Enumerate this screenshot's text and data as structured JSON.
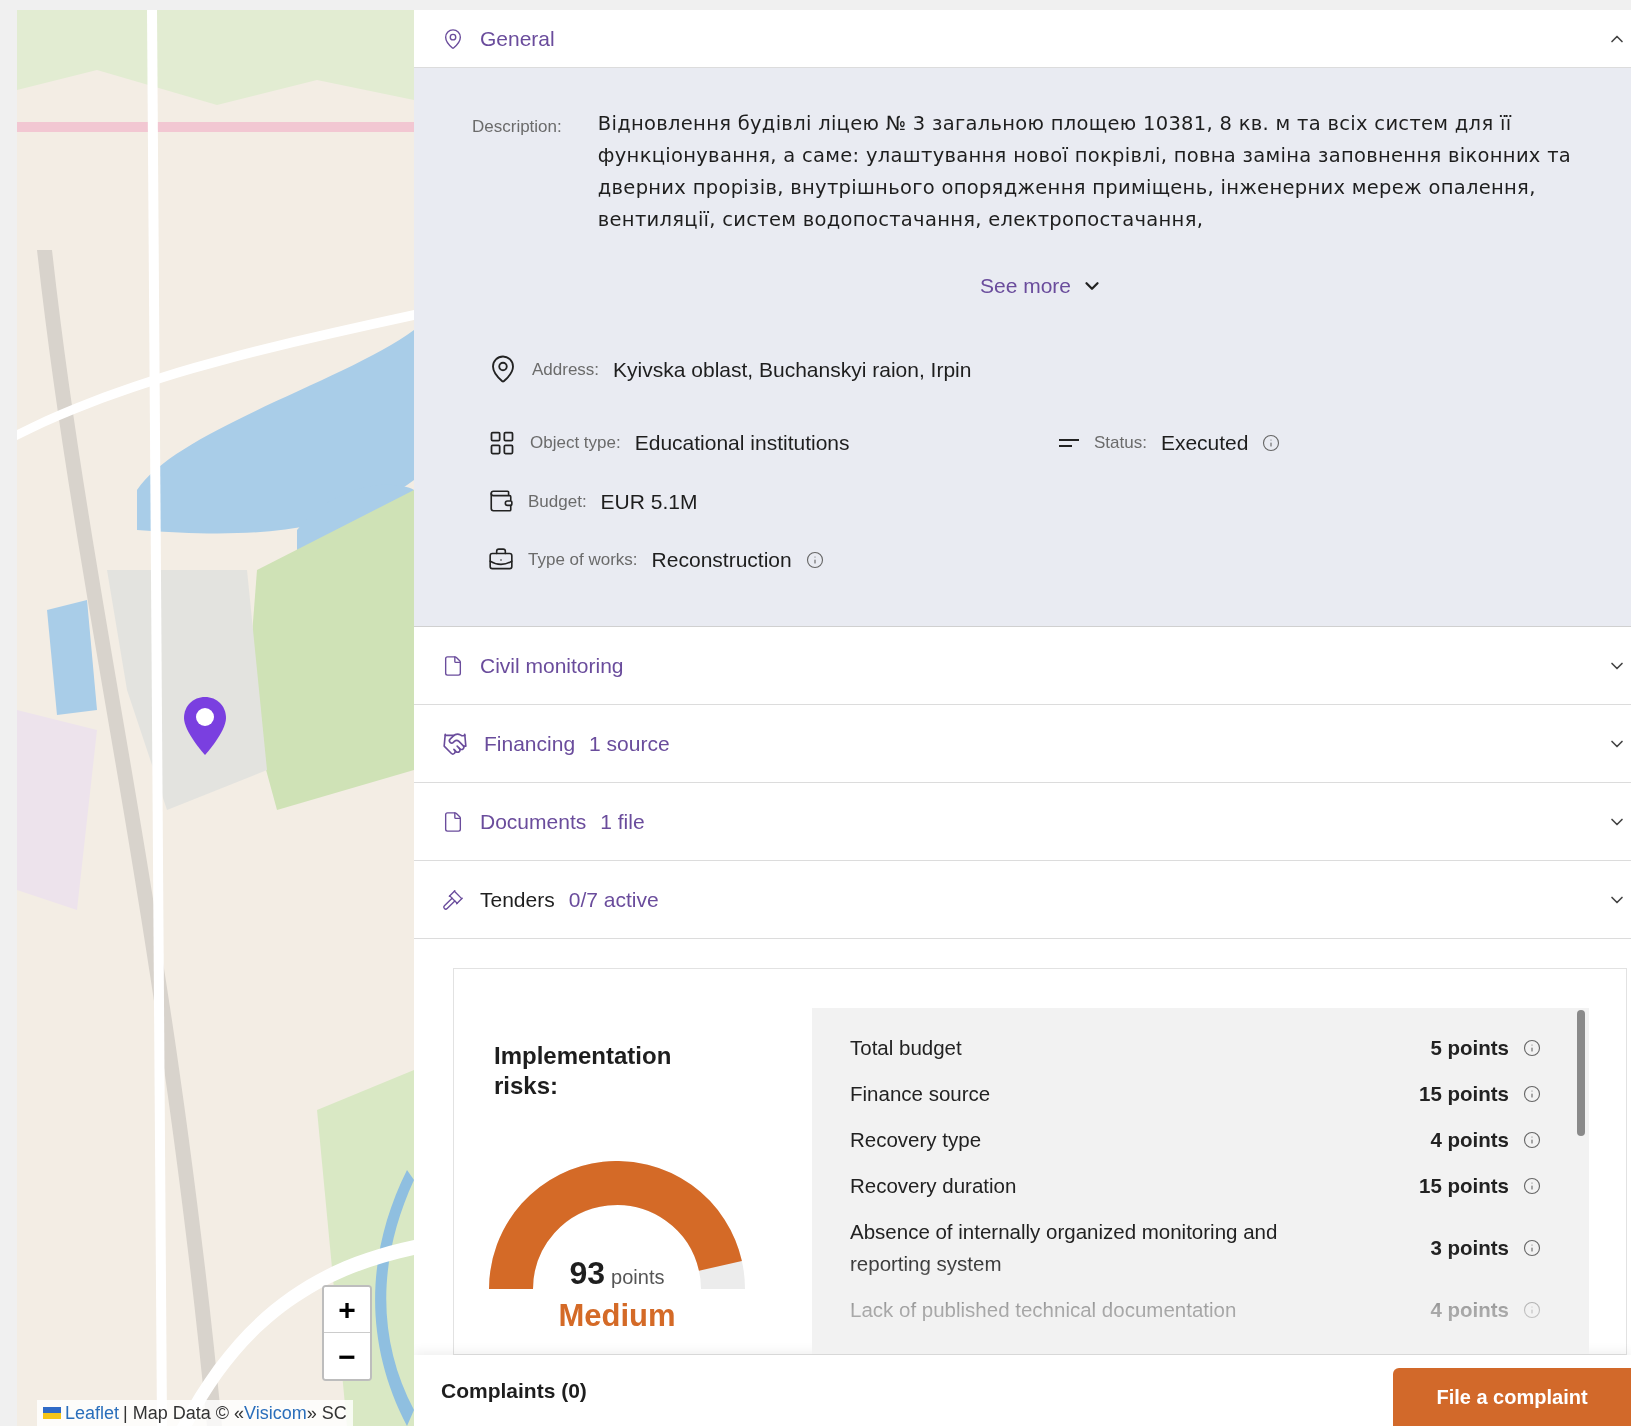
{
  "map": {
    "zoom_in": "+",
    "zoom_out": "−",
    "attribution": {
      "link": "Leaflet",
      "middle": "| Map Data © «",
      "source": "Visicom",
      "end": "» SC"
    }
  },
  "sections": [
    {
      "kind": "general",
      "title": "General",
      "expanded": true
    },
    {
      "kind": "monitoring",
      "title": "Civil monitoring",
      "expanded": false
    },
    {
      "kind": "financing",
      "title": "Financing",
      "count": "1 source",
      "expanded": false
    },
    {
      "kind": "documents",
      "title": "Documents",
      "count": "1 file",
      "expanded": false
    },
    {
      "kind": "tenders",
      "title": "Tenders",
      "count": "0/7 active",
      "expanded": false
    }
  ],
  "general": {
    "description_label": "Description:",
    "description": "Відновлення будівлі ліцею № 3 загальною площею 10381, 8 кв. м та всіх систем для її функціонування, а саме: улаштування нової покрівлі, повна заміна заповнення віконних та дверних прорізів, внутрішнього опорядження приміщень, інженерних мереж опалення, вентиляції, систем водопостачання, електропостачання,",
    "see_more": "See more",
    "address": {
      "label": "Address:",
      "value": "Kyivska oblast, Buchanskyi raion, Irpin"
    },
    "object_type": {
      "label": "Object type:",
      "value": "Educational institutions"
    },
    "status": {
      "label": "Status:",
      "value": "Executed",
      "info": true
    },
    "budget": {
      "label": "Budget:",
      "value": "EUR 5.1M"
    },
    "type_of_works": {
      "label": "Type of works:",
      "value": "Reconstruction",
      "info": true
    }
  },
  "risks": {
    "title": "Implementation risks:",
    "score": "93",
    "score_unit": "points",
    "rating": "Medium",
    "items": [
      {
        "label": "Total budget",
        "points": "5 points"
      },
      {
        "label": "Finance source",
        "points": "15 points"
      },
      {
        "label": "Recovery type",
        "points": "4 points"
      },
      {
        "label": "Recovery duration",
        "points": "15 points"
      },
      {
        "label": "Absence of internally organized monitoring and reporting system",
        "points": "3 points"
      },
      {
        "label": "Lack of published technical documentation",
        "points": "4 points"
      }
    ]
  },
  "footer": {
    "complaints": "Complaints (0)",
    "button": "File a complaint"
  }
}
